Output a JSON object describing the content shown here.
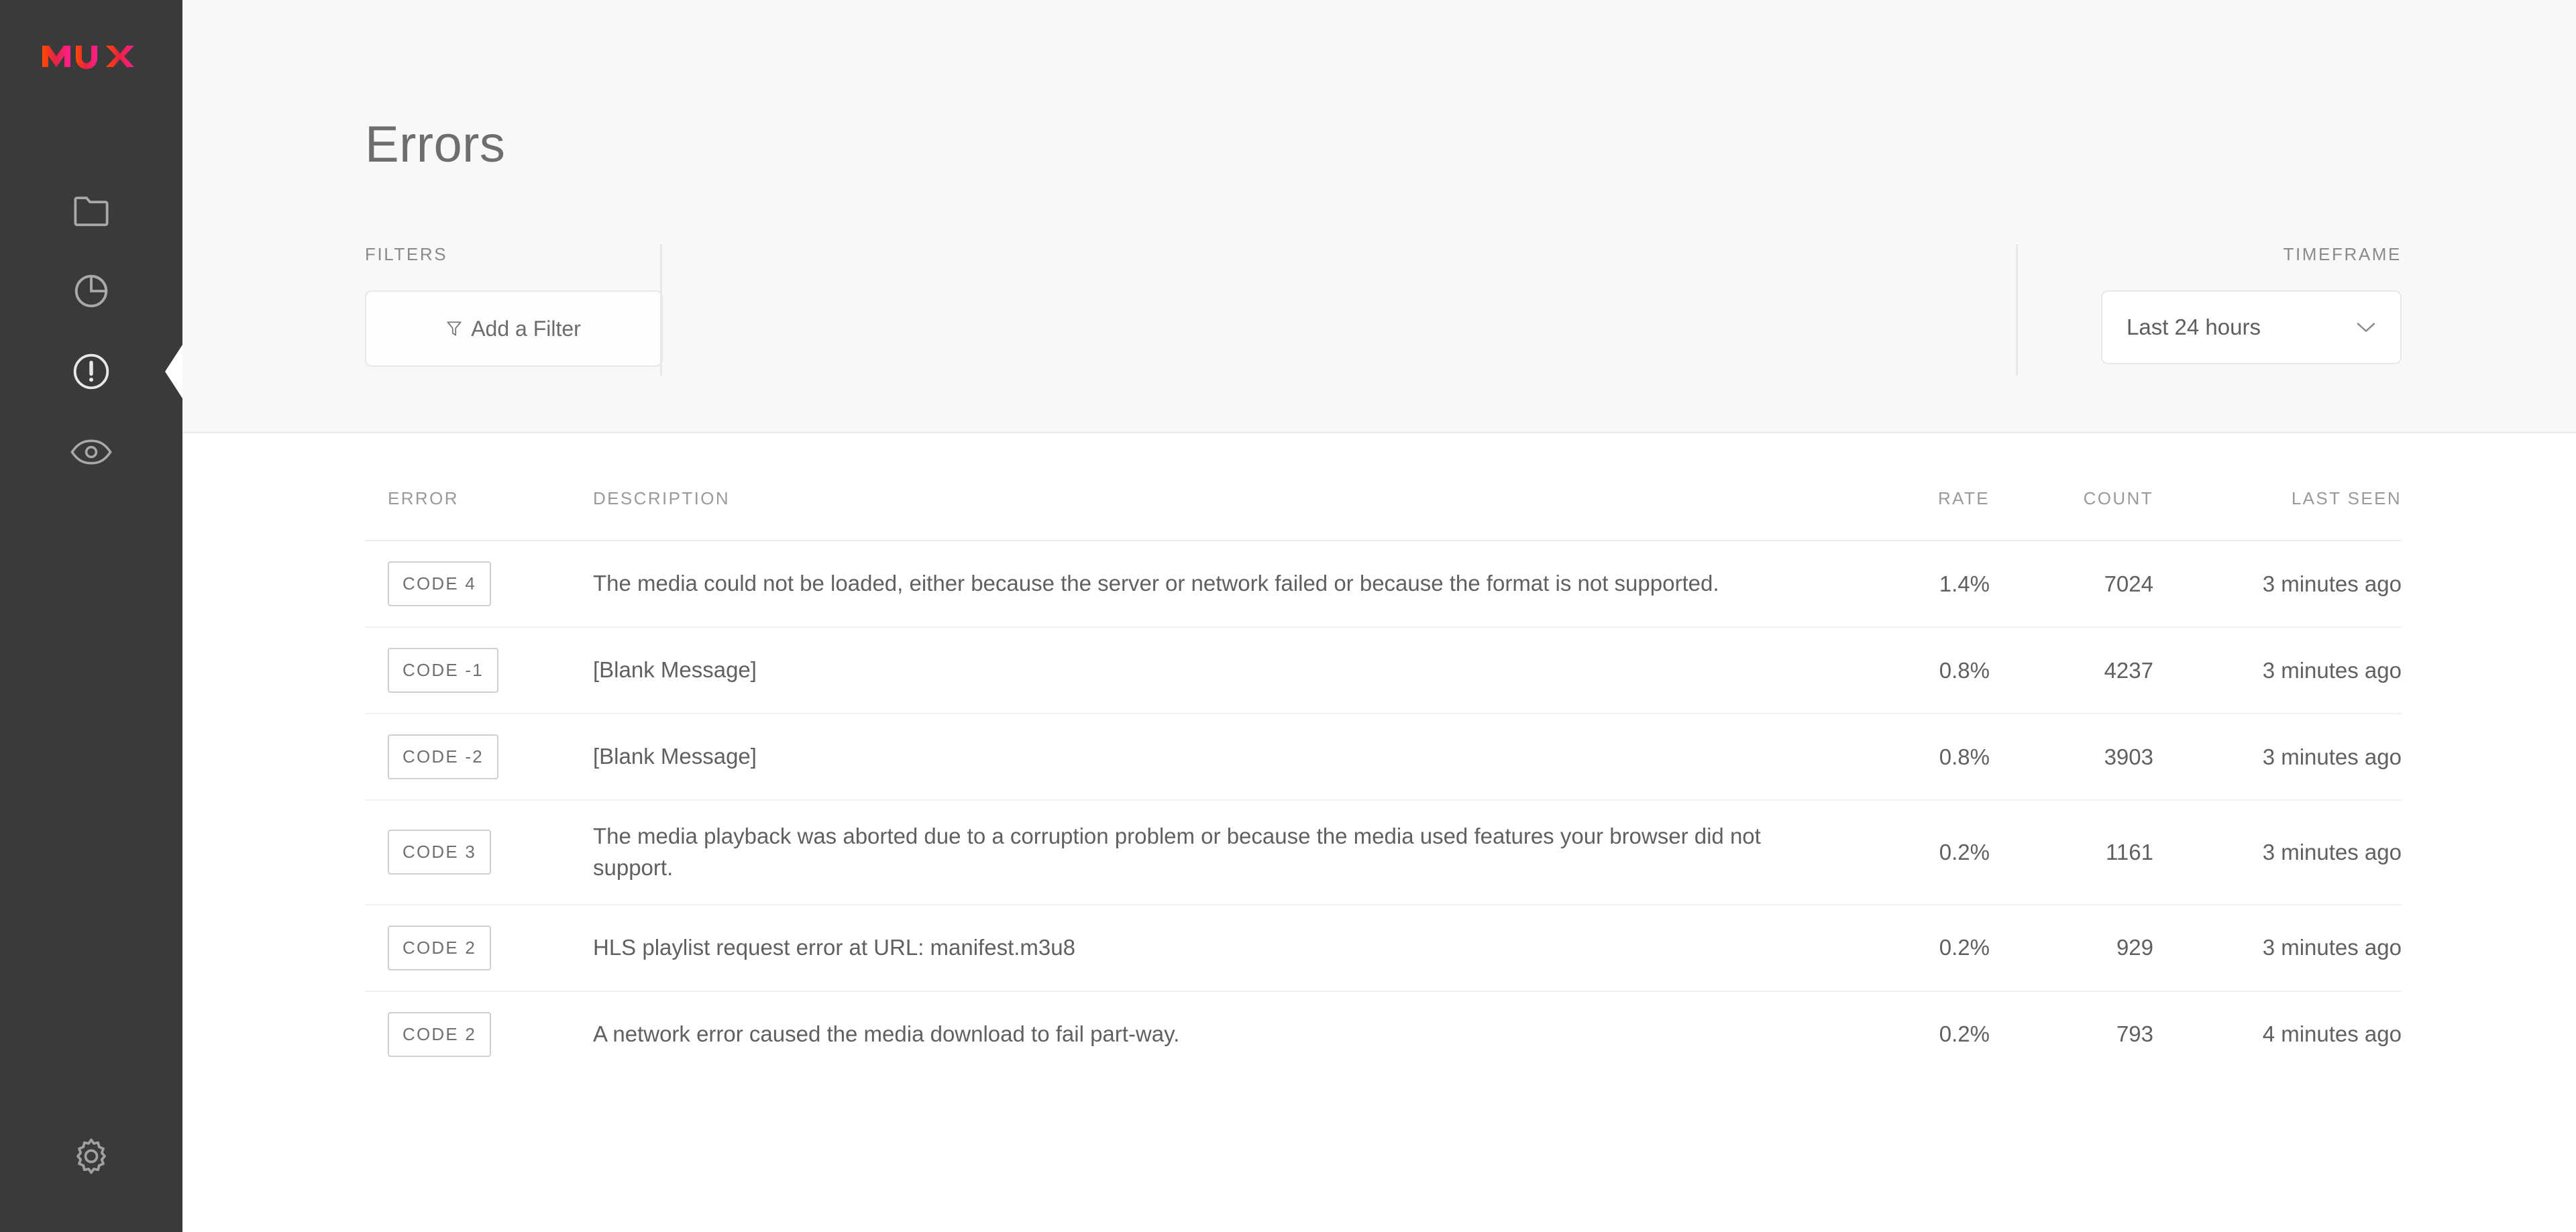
{
  "brand": {
    "logo_text": "MUX",
    "gradient_start": "#ff4000",
    "gradient_end": "#ff1e8e"
  },
  "sidebar": {
    "items": [
      {
        "icon": "folder-icon",
        "name": "sidebar-item-assets",
        "active": false
      },
      {
        "icon": "pie-chart-icon",
        "name": "sidebar-item-metrics",
        "active": false
      },
      {
        "icon": "alert-circle-icon",
        "name": "sidebar-item-errors",
        "active": true
      },
      {
        "icon": "eye-icon",
        "name": "sidebar-item-monitoring",
        "active": false
      }
    ],
    "settings": {
      "icon": "gear-icon",
      "name": "sidebar-item-settings"
    }
  },
  "header": {
    "title": "Errors"
  },
  "filters": {
    "label": "FILTERS",
    "add_filter_label": "Add a Filter",
    "funnel_icon": "filter-funnel-icon"
  },
  "timeframe": {
    "label": "TIMEFRAME",
    "selected": "Last 24 hours",
    "chevron_icon": "chevron-down-icon"
  },
  "table": {
    "columns": {
      "error": "ERROR",
      "description": "DESCRIPTION",
      "rate": "RATE",
      "count": "COUNT",
      "last_seen": "LAST SEEN"
    },
    "rows": [
      {
        "code": "CODE  4",
        "description": "The media could not be loaded, either because the server or network failed or because the format is not supported.",
        "rate": "1.4%",
        "count": "7024",
        "last_seen": "3 minutes ago"
      },
      {
        "code": "CODE -1",
        "description": "[Blank Message]",
        "rate": "0.8%",
        "count": "4237",
        "last_seen": "3 minutes ago"
      },
      {
        "code": "CODE -2",
        "description": "[Blank Message]",
        "rate": "0.8%",
        "count": "3903",
        "last_seen": "3 minutes ago"
      },
      {
        "code": "CODE  3",
        "description": "The media playback was aborted due to a corruption problem or because the media used features your browser did not support.",
        "rate": "0.2%",
        "count": "1161",
        "last_seen": "3 minutes ago"
      },
      {
        "code": "CODE  2",
        "description": "HLS playlist request error at URL: manifest.m3u8",
        "rate": "0.2%",
        "count": "929",
        "last_seen": "3 minutes ago"
      },
      {
        "code": "CODE  2",
        "description": "A network error caused the media download to fail part-way.",
        "rate": "0.2%",
        "count": "793",
        "last_seen": "4 minutes ago"
      }
    ]
  },
  "colors": {
    "sidebar_bg": "#3a3a3a",
    "top_section_bg": "#f8f8f8",
    "table_bg": "#ffffff",
    "text_primary": "#606060",
    "text_muted": "#9a9a9a",
    "border": "#e8e8e8"
  }
}
